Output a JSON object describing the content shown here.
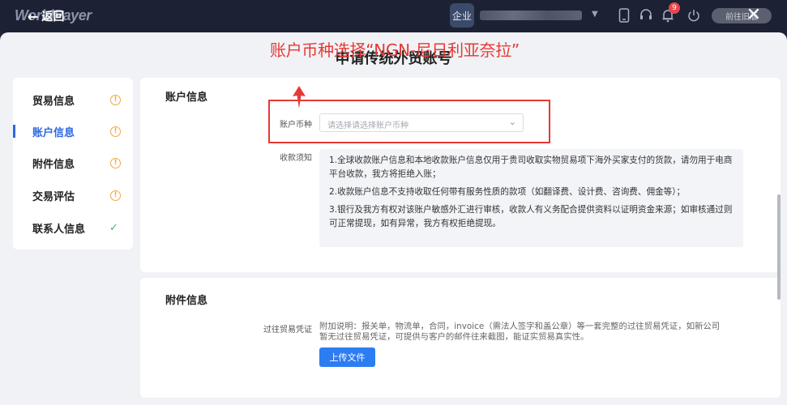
{
  "topbar": {
    "logo_text": "WorldPayer",
    "back_label": "返回",
    "enterprise_badge": "企业",
    "notification_count": "9",
    "go_button_label": "前往旧版",
    "close_glyph": "✕"
  },
  "page_title": "申请传统外贸账号",
  "sidebar": {
    "items": [
      {
        "label": "贸易信息",
        "status": "warning",
        "active": false
      },
      {
        "label": "账户信息",
        "status": "warning",
        "active": true
      },
      {
        "label": "附件信息",
        "status": "warning",
        "active": false
      },
      {
        "label": "交易评估",
        "status": "warning",
        "active": false
      },
      {
        "label": "联系人信息",
        "status": "done",
        "active": false
      }
    ]
  },
  "account_section": {
    "title": "账户信息",
    "currency_label": "账户币种",
    "currency_placeholder": "请选择请选择账户币种",
    "notice_label": "收款须知",
    "notices": [
      "1.全球收款账户信息和本地收款账户信息仅用于贵司收取实物贸易项下海外买家支付的货款，请勿用于电商平台收款，我方将拒绝入账；",
      "2.收款账户信息不支持收取任何带有服务性质的款项（如翻译费、设计费、咨询费、佣金等）；",
      "3.银行及我方有权对该账户敏感外汇进行审核，收款人有义务配合提供资料以证明资金来源；如审核通过则可正常提现，如有异常，我方有权拒绝提现。"
    ]
  },
  "annotation": {
    "text": "账户币种选择“NGN-尼日利亚奈拉”",
    "color": "#e53935"
  },
  "attachment_section": {
    "title": "附件信息",
    "field_label": "过往贸易凭证",
    "hint": "附加说明：报关单，物流单，合同，invoice（需法人签字和盖公章）等一套完整的过往贸易凭证，如新公司暂无过往贸易凭证，可提供与客户的邮件往来截图，能证实贸易真实性。",
    "upload_label": "上传文件"
  },
  "colors": {
    "primary": "#2d7df2",
    "active_nav": "#2d68e0",
    "warning": "#f2a93b",
    "success": "#3bb56b",
    "annotation": "#e53935"
  },
  "icons": [
    "back-arrow-icon",
    "phone-icon",
    "headset-icon",
    "bell-icon",
    "power-icon",
    "close-icon",
    "chevron-down-icon",
    "info-circle-icon",
    "check-icon"
  ]
}
